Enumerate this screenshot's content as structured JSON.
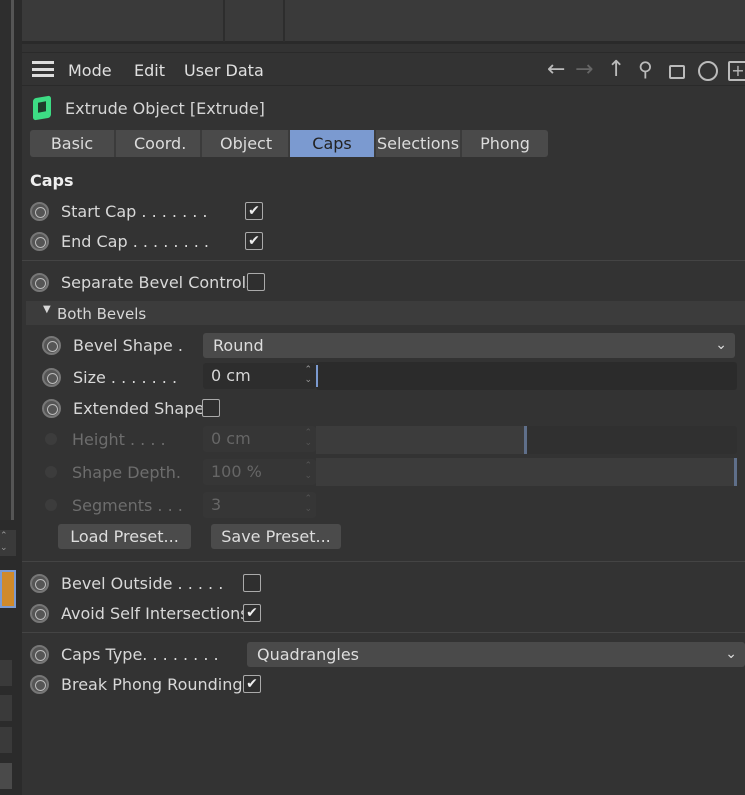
{
  "menu": {
    "items": [
      "Mode",
      "Edit",
      "User Data"
    ],
    "toolbar_icons": [
      "arrow-left-icon",
      "arrow-right-icon",
      "arrow-up-icon",
      "search-icon",
      "lock-icon",
      "target-icon",
      "new-panel-icon"
    ]
  },
  "object": {
    "title": "Extrude Object [Extrude]",
    "icon": "extrude-cube-icon",
    "icon_color": "#3ddc84"
  },
  "tabs": [
    {
      "label": "Basic"
    },
    {
      "label": "Coord."
    },
    {
      "label": "Object"
    },
    {
      "label": "Caps",
      "active": true
    },
    {
      "label": "Selections"
    },
    {
      "label": "Phong"
    }
  ],
  "section_title": "Caps",
  "start_cap": {
    "label": "Start Cap . . . . . . .",
    "checked": true
  },
  "end_cap": {
    "label": "End Cap . . . . . . . .",
    "checked": true
  },
  "separate_bevel": {
    "label": "Separate Bevel Controls",
    "checked": false
  },
  "group": {
    "label": "Both Bevels",
    "expanded": true
  },
  "bevel_shape": {
    "label": "Bevel Shape .",
    "value": "Round"
  },
  "size": {
    "label": "Size . . . . . . .",
    "value": "0 cm",
    "slider_fraction": 0
  },
  "extended_shape": {
    "label": "Extended Shape",
    "checked": false
  },
  "height": {
    "label": "Height . . . .",
    "value": "0 cm",
    "slider_fraction": 0.5,
    "disabled": true
  },
  "shape_depth": {
    "label": "Shape Depth.",
    "value": "100 %",
    "slider_fraction": 1.0,
    "disabled": true
  },
  "segments": {
    "label": "Segments . . .",
    "value": "3",
    "disabled": true
  },
  "load_preset": "Load Preset...",
  "save_preset": "Save Preset...",
  "bevel_outside": {
    "label": "Bevel Outside . . . . .",
    "checked": false
  },
  "avoid_self": {
    "label": "Avoid Self Intersections",
    "checked": true
  },
  "caps_type": {
    "label": "Caps Type. . . . . . . .",
    "value": "Quadrangles"
  },
  "break_phong": {
    "label": "Break Phong Rounding",
    "checked": true
  },
  "accent": "#7b9ad0"
}
